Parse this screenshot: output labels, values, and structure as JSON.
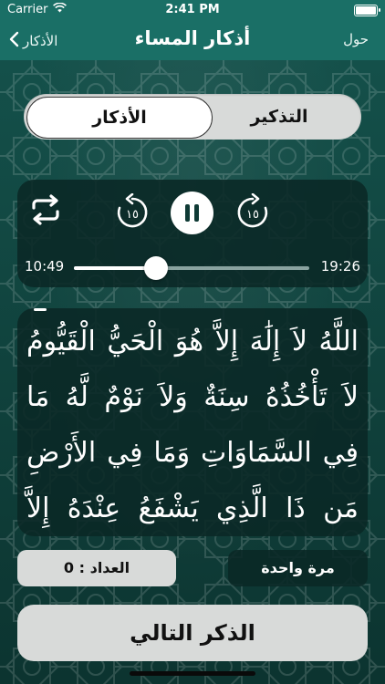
{
  "status_bar": {
    "carrier": "Carrier",
    "time": "2:41 PM"
  },
  "nav": {
    "back_label": "الأذكار",
    "title": "أذكار المساء",
    "about_label": "حول"
  },
  "segments": {
    "active": "الأذكار",
    "inactive": "التذكير"
  },
  "player": {
    "rewind_label": "١٥",
    "forward_label": "١٥",
    "elapsed": "10:49",
    "remaining": "19:26",
    "progress": 0.35
  },
  "dhikr_text": "اللَّهُ لاَ إِلَٰهَ إِلاَّ هُوَ الْحَيُّ الْقَيُّومُ لاَ تَأْخُذُهُ سِنَةٌ وَلاَ نَوْمٌ لَّهُ مَا فِي السَّمَاوَاتِ وَمَا فِي الأَرْضِ مَن ذَا الَّذِي يَشْفَعُ عِنْدَهُ إِلاَّ بِإِذْنِهِ يَعْلَمُ مَا",
  "counter_label": "العداد : 0",
  "repeat_label": "مرة واحدة",
  "next_label": "الذكر التالي"
}
